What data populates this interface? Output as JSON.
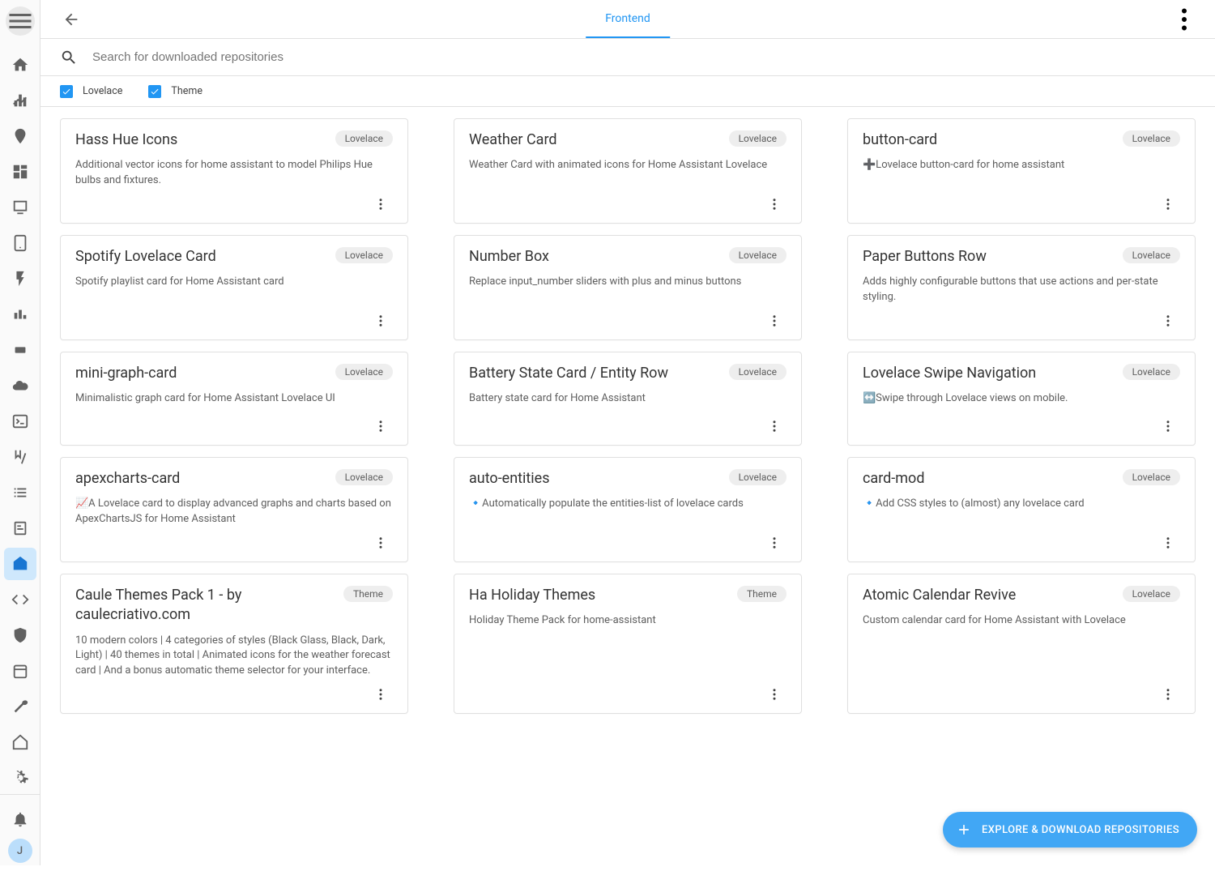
{
  "header": {
    "tab_label": "Frontend"
  },
  "search": {
    "placeholder": "Search for downloaded repositories"
  },
  "filters": {
    "lovelace": "Lovelace",
    "theme": "Theme"
  },
  "fab": {
    "label": "EXPLORE & DOWNLOAD REPOSITORIES"
  },
  "badges": {
    "lovelace": "Lovelace",
    "theme": "Theme"
  },
  "avatar": {
    "initial": "J"
  },
  "cards": [
    {
      "title": "Hass Hue Icons",
      "badge": "lovelace",
      "desc": "Additional vector icons for home assistant to model Philips Hue bulbs and fixtures."
    },
    {
      "title": "Weather Card",
      "badge": "lovelace",
      "desc": "Weather Card with animated icons for Home Assistant Lovelace"
    },
    {
      "title": "button-card",
      "badge": "lovelace",
      "desc": "➕Lovelace button-card for home assistant"
    },
    {
      "title": "Spotify Lovelace Card",
      "badge": "lovelace",
      "desc": "Spotify playlist card for Home Assistant card"
    },
    {
      "title": "Number Box",
      "badge": "lovelace",
      "desc": "Replace input_number sliders with plus and minus buttons"
    },
    {
      "title": "Paper Buttons Row",
      "badge": "lovelace",
      "desc": "Adds highly configurable buttons that use actions and per-state styling."
    },
    {
      "title": "mini-graph-card",
      "badge": "lovelace",
      "desc": "Minimalistic graph card for Home Assistant Lovelace UI"
    },
    {
      "title": "Battery State Card / Entity Row",
      "badge": "lovelace",
      "desc": "Battery state card for Home Assistant"
    },
    {
      "title": "Lovelace Swipe Navigation",
      "badge": "lovelace",
      "desc": "↔️Swipe through Lovelace views on mobile."
    },
    {
      "title": "apexcharts-card",
      "badge": "lovelace",
      "desc": "📈A Lovelace card to display advanced graphs and charts based on ApexChartsJS for Home Assistant"
    },
    {
      "title": "auto-entities",
      "badge": "lovelace",
      "desc": "🔹Automatically populate the entities-list of lovelace cards"
    },
    {
      "title": "card-mod",
      "badge": "lovelace",
      "desc": "🔹Add CSS styles to (almost) any lovelace card"
    },
    {
      "title": "Caule Themes Pack 1 - by caulecriativo.com",
      "badge": "theme",
      "desc": "10 modern colors | 4 categories of styles (Black Glass, Black, Dark, Light) | 40 themes in total | Animated icons for the weather forecast card | And a bonus automatic theme selector for your interface."
    },
    {
      "title": "Ha Holiday Themes",
      "badge": "theme",
      "desc": "Holiday Theme Pack for home-assistant"
    },
    {
      "title": "Atomic Calendar Revive",
      "badge": "lovelace",
      "desc": "Custom calendar card for Home Assistant with Lovelace"
    }
  ]
}
